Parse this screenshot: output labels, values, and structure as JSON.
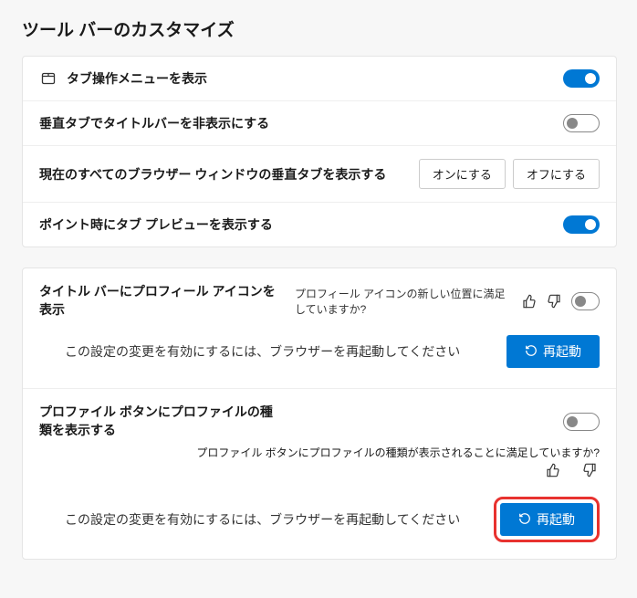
{
  "page": {
    "title": "ツール バーのカスタマイズ"
  },
  "rows": {
    "tabmenu": {
      "label": "タブ操作メニューを表示"
    },
    "hidetitle": {
      "label": "垂直タブでタイトルバーを非表示にする"
    },
    "allwin": {
      "label": "現在のすべてのブラウザー ウィンドウの垂直タブを表示する",
      "on_btn": "オンにする",
      "off_btn": "オフにする"
    },
    "preview": {
      "label": "ポイント時にタブ プレビューを表示する"
    }
  },
  "profile": {
    "icon": {
      "title": "タイトル バーにプロフィール アイコンを表示",
      "question": "プロフィール アイコンの新しい位置に満足していますか?",
      "restart_msg": "この設定の変更を有効にするには、ブラウザーを再起動してください",
      "restart_btn": "再起動"
    },
    "type": {
      "title": "プロファイル ボタンにプロファイルの種類を表示する",
      "question": "プロファイル ボタンにプロファイルの種類が表示されることに満足していますか?",
      "restart_msg": "この設定の変更を有効にするには、ブラウザーを再起動してください",
      "restart_btn": "再起動"
    }
  }
}
